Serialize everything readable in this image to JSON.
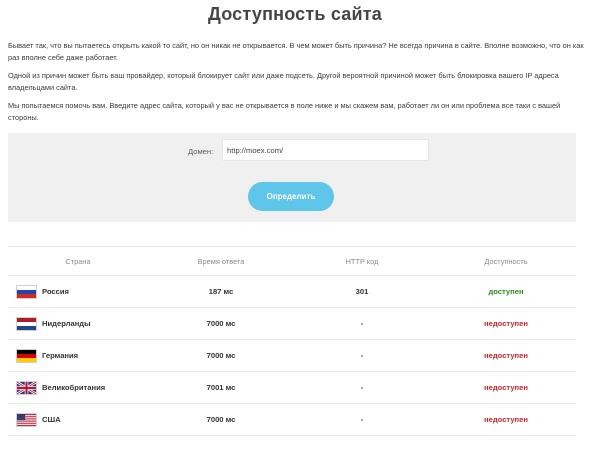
{
  "header": {
    "title": "Доступность сайта"
  },
  "intro": {
    "p1": "Бывает так, что вы пытаетесь открыть какой то сайт, но он никак не открывается. В чем может быть причина? Не всегда причина в сайте. Вполне возможно, что он как раз вполне себе даже работает.",
    "p2": "Одной из причин может быть ваш провайдер, который блокирует сайт или даже подсеть. Другой вероятной причиной может быть блокировка вашего IP адреса владельцами сайта.",
    "p3": "Мы попытаемся помочь вам. Введите адрес сайта, который у вас не открывается в поле ниже и мы скажем вам, работает ли он или проблема все таки с вашей стороны."
  },
  "form": {
    "domain_label": "Домен:",
    "domain_value": "http://moex.com/",
    "submit_label": "Определить"
  },
  "results": {
    "headers": {
      "country": "Страна",
      "time": "Время ответа",
      "http": "HTTP код",
      "status": "Доступность"
    },
    "rows": [
      {
        "flag": "flag-russia-icon",
        "country": "Россия",
        "time": "187 мс",
        "http": "301",
        "status": "доступен",
        "ok": true
      },
      {
        "flag": "flag-netherlands-icon",
        "country": "Нидерланды",
        "time": "7000 мс",
        "http": "-",
        "status": "недоступен",
        "ok": false
      },
      {
        "flag": "flag-germany-icon",
        "country": "Германия",
        "time": "7000 мс",
        "http": "-",
        "status": "недоступен",
        "ok": false
      },
      {
        "flag": "flag-uk-icon",
        "country": "Великобритания",
        "time": "7001 мс",
        "http": "-",
        "status": "недоступен",
        "ok": false
      },
      {
        "flag": "flag-usa-icon",
        "country": "США",
        "time": "7000 мс",
        "http": "-",
        "status": "недоступен",
        "ok": false
      }
    ]
  },
  "colors": {
    "available": "#2b8a1a",
    "unavailable": "#d3222a",
    "button": "#5ec5eb",
    "form_bg": "#f0f0f0"
  }
}
